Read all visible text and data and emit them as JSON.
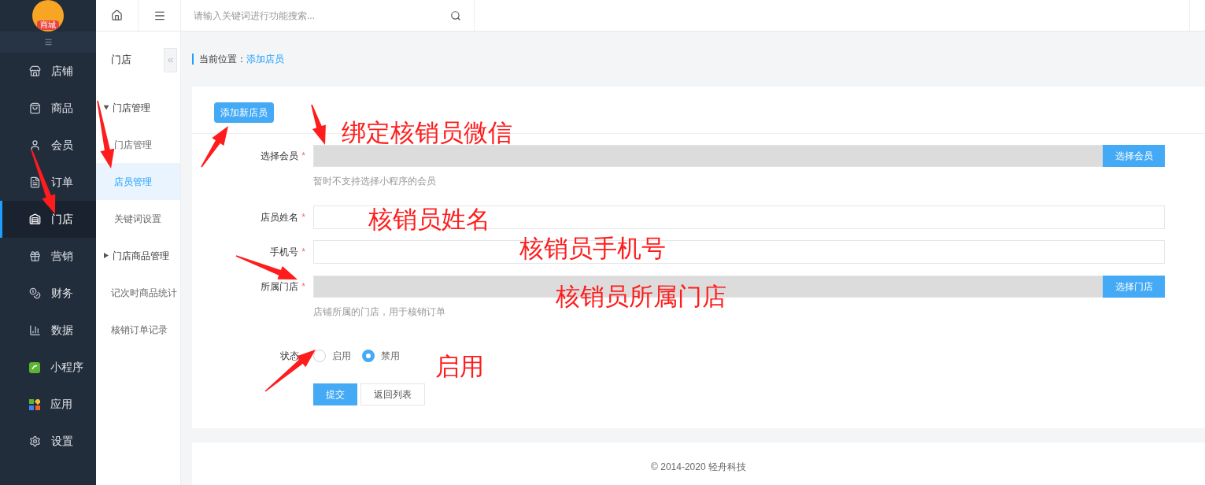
{
  "logo": {
    "label": "商城"
  },
  "sidebar": {
    "items": [
      {
        "label": "店铺",
        "selected": false
      },
      {
        "label": "商品",
        "selected": false
      },
      {
        "label": "会员",
        "selected": false
      },
      {
        "label": "订单",
        "selected": false
      },
      {
        "label": "门店",
        "selected": true
      },
      {
        "label": "营销",
        "selected": false
      },
      {
        "label": "财务",
        "selected": false
      },
      {
        "label": "数据",
        "selected": false
      },
      {
        "label": "小程序",
        "selected": false
      },
      {
        "label": "应用",
        "selected": false
      },
      {
        "label": "设置",
        "selected": false
      }
    ]
  },
  "subnav": {
    "title": "门店",
    "items": [
      {
        "label": "门店管理",
        "kind": "group",
        "expanded": true
      },
      {
        "label": "门店管理",
        "kind": "link",
        "selected": false
      },
      {
        "label": "店员管理",
        "kind": "link",
        "selected": true
      },
      {
        "label": "关键词设置",
        "kind": "link",
        "selected": false
      },
      {
        "label": "门店商品管理",
        "kind": "group",
        "expanded": false
      },
      {
        "label": "记次时商品统计",
        "kind": "top",
        "selected": false
      },
      {
        "label": "核销订单记录",
        "kind": "top",
        "selected": false
      }
    ]
  },
  "search": {
    "placeholder": "请输入关键词进行功能搜索..."
  },
  "breadcrumb": {
    "label": "当前位置：",
    "current": "添加店员"
  },
  "add_button": "添加新店员",
  "form": {
    "fields": [
      {
        "label": "选择会员",
        "required_mark": "*",
        "kind": "picker",
        "button": "选择会员",
        "hint": "暂时不支持选择小程序的会员"
      },
      {
        "label": "店员姓名",
        "required_mark": "*",
        "kind": "text"
      },
      {
        "label": "手机号",
        "required_mark": "*",
        "kind": "text"
      },
      {
        "label": "所属门店",
        "required_mark": "*",
        "kind": "picker",
        "button": "选择门店",
        "hint": "店铺所属的门店，用于核销订单"
      }
    ],
    "status": {
      "label": "状态",
      "options": [
        {
          "label": "启用",
          "selected": false
        },
        {
          "label": "禁用",
          "selected": true
        }
      ]
    },
    "actions": [
      {
        "label": "提交",
        "kind": "primary"
      },
      {
        "label": "返回列表",
        "kind": "default"
      }
    ]
  },
  "footer": "© 2014-2020 轻舟科技",
  "annotations": [
    {
      "text": "绑定核销员微信"
    },
    {
      "text": "核销员姓名"
    },
    {
      "text": "核销员手机号"
    },
    {
      "text": "核销员所属门店"
    },
    {
      "text": "启用"
    }
  ]
}
